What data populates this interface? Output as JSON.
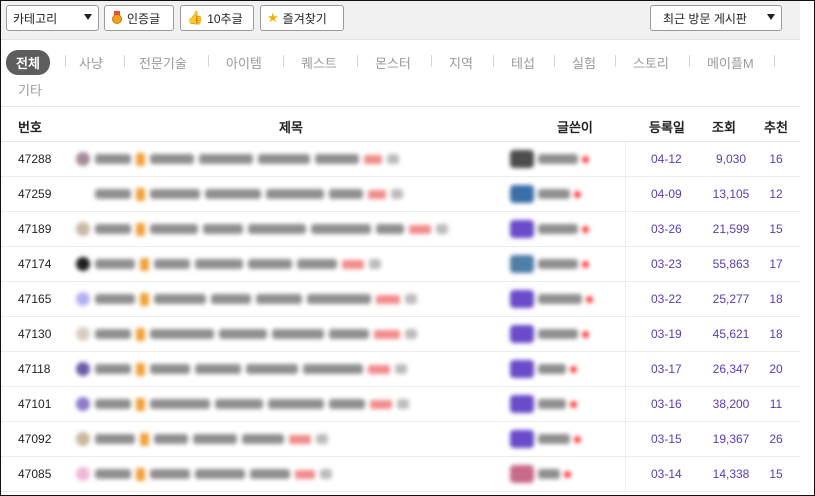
{
  "toolbar": {
    "category_label": "카테고리",
    "certified_label": "인증글",
    "ten_rec_label": "10추글",
    "favorites_label": "즐겨찾기",
    "recent_label": "최근 방문 게시판"
  },
  "tabs": [
    {
      "label": "전체",
      "active": true
    },
    {
      "label": "사냥"
    },
    {
      "label": "전문기술"
    },
    {
      "label": "아이템"
    },
    {
      "label": "퀘스트"
    },
    {
      "label": "몬스터"
    },
    {
      "label": "지역"
    },
    {
      "label": "테섭"
    },
    {
      "label": "실험"
    },
    {
      "label": "스토리"
    },
    {
      "label": "메이플M"
    },
    {
      "label": "기타"
    }
  ],
  "columns": {
    "number": "번호",
    "title": "제목",
    "author": "글쓴이",
    "date": "등록일",
    "views": "조회",
    "recommend": "추천"
  },
  "rows": [
    {
      "number": "47288",
      "date": "04-12",
      "views": "9,030",
      "recommend": "16"
    },
    {
      "number": "47259",
      "date": "04-09",
      "views": "13,105",
      "recommend": "12"
    },
    {
      "number": "47189",
      "date": "03-26",
      "views": "21,599",
      "recommend": "15"
    },
    {
      "number": "47174",
      "date": "03-23",
      "views": "55,863",
      "recommend": "17"
    },
    {
      "number": "47165",
      "date": "03-22",
      "views": "25,277",
      "recommend": "18"
    },
    {
      "number": "47130",
      "date": "03-19",
      "views": "45,621",
      "recommend": "18"
    },
    {
      "number": "47118",
      "date": "03-17",
      "views": "26,347",
      "recommend": "20"
    },
    {
      "number": "47101",
      "date": "03-16",
      "views": "38,200",
      "recommend": "11"
    },
    {
      "number": "47092",
      "date": "03-15",
      "views": "19,367",
      "recommend": "26"
    },
    {
      "number": "47085",
      "date": "03-14",
      "views": "14,338",
      "recommend": "15"
    }
  ],
  "colors": {
    "accent": "#5a3bb0",
    "active_tab": "#5d5d5d"
  }
}
